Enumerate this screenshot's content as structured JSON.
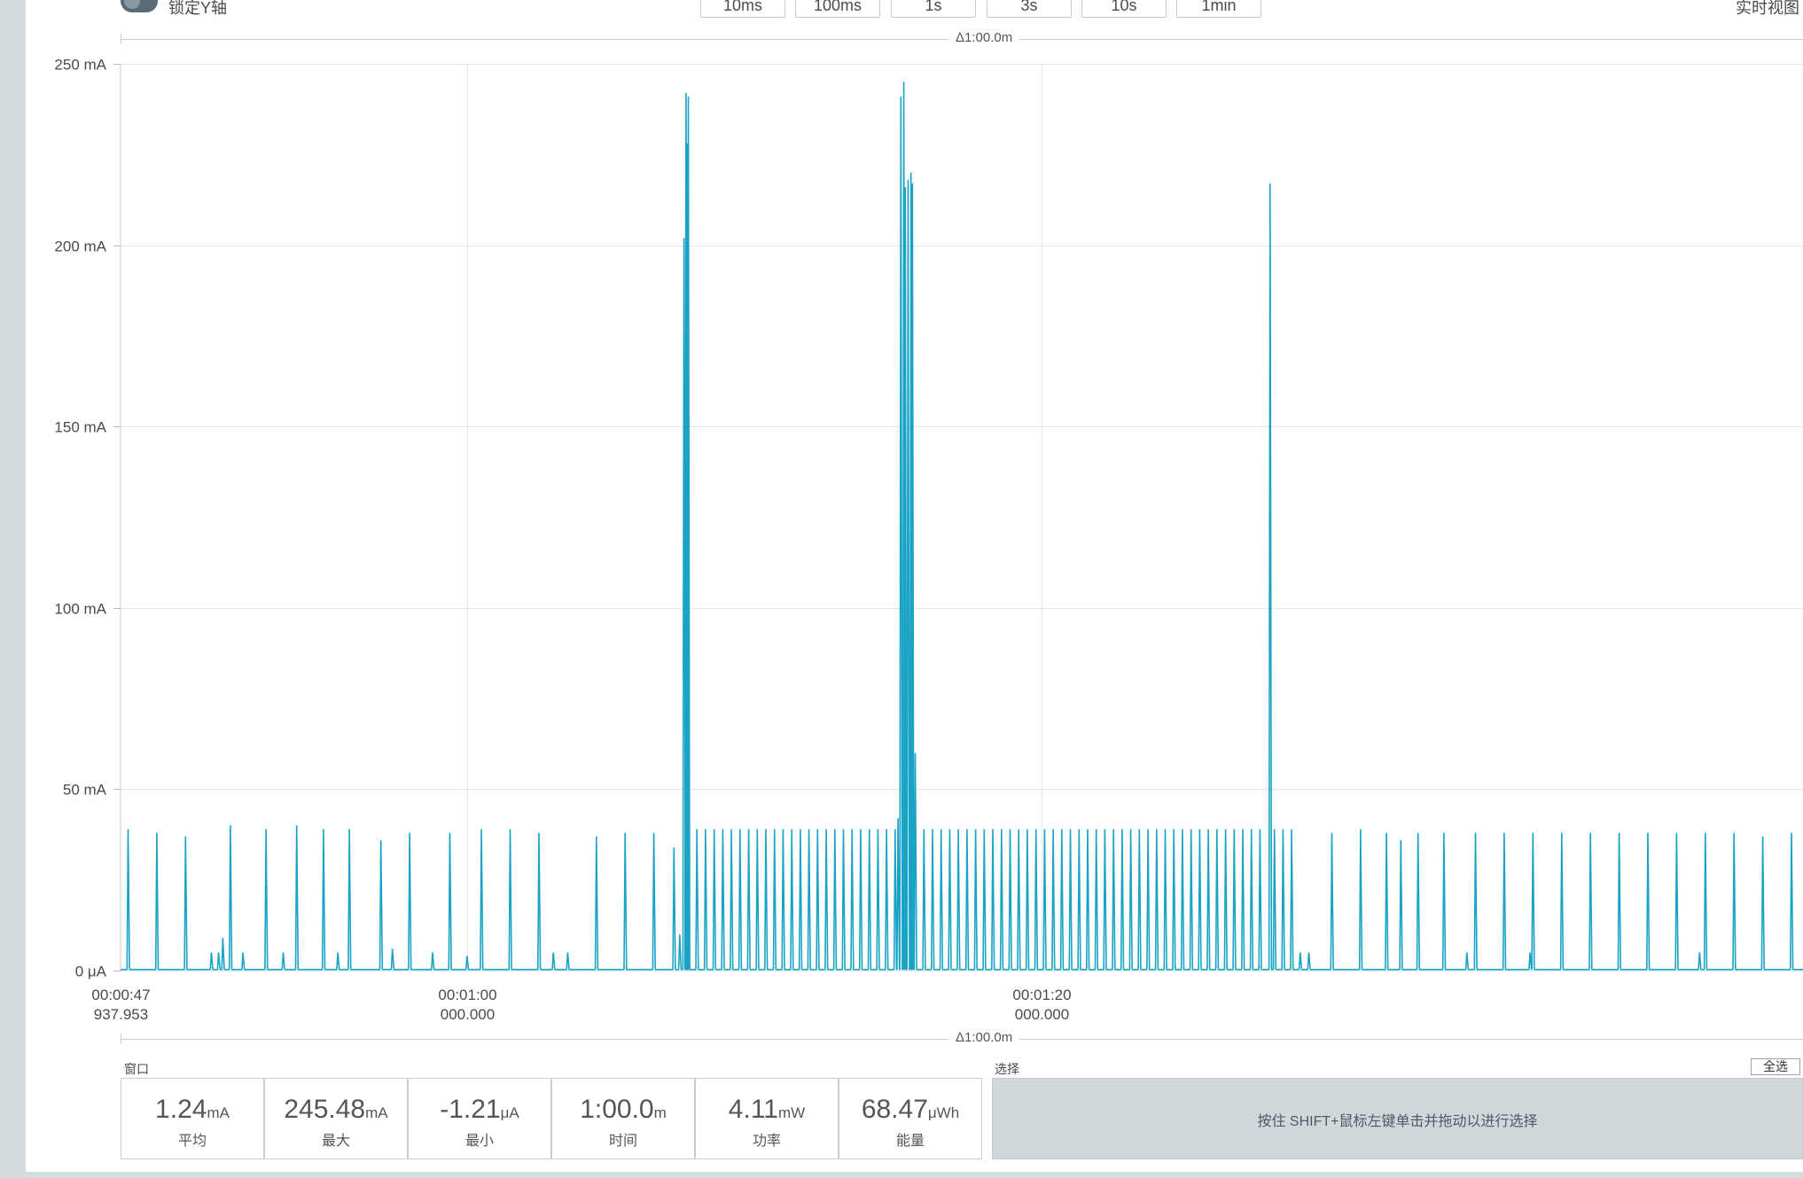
{
  "toolbar": {
    "lock_y_label": "锁定Y轴",
    "window_buttons": [
      "10ms",
      "100ms",
      "1s",
      "3s",
      "10s",
      "1min"
    ],
    "live_view_label": "实时视图"
  },
  "ruler": {
    "top_label": "Δ1:00.0m",
    "bottom_label": "Δ1:00.0m"
  },
  "chart_data": {
    "type": "line",
    "title": "",
    "xlabel": "",
    "ylabel": "",
    "y_unit": "mA",
    "ylim": [
      0,
      250
    ],
    "x_unit": "s",
    "xlim": [
      47.937953,
      106.5
    ],
    "y_ticks": [
      {
        "value": 0,
        "label": "0 μA"
      },
      {
        "value": 50,
        "label": "50 mA"
      },
      {
        "value": 100,
        "label": "100 mA"
      },
      {
        "value": 150,
        "label": "150 mA"
      },
      {
        "value": 200,
        "label": "200 mA"
      },
      {
        "value": 250,
        "label": "250 mA"
      }
    ],
    "x_ticks": [
      {
        "value": 47.937953,
        "line1": "00:00:47",
        "line2": "937.953"
      },
      {
        "value": 60,
        "line1": "00:01:00",
        "line2": "000.000"
      },
      {
        "value": 80,
        "line1": "00:01:20",
        "line2": "000.000"
      }
    ],
    "grid": true,
    "color": "#1ba3c6",
    "series": [
      {
        "baseline_mA": 0.3,
        "spikes": [
          {
            "t": 48.2,
            "v": 39
          },
          {
            "t": 49.2,
            "v": 38
          },
          {
            "t": 50.2,
            "v": 37
          },
          {
            "t": 51.1,
            "v": 5
          },
          {
            "t": 51.35,
            "v": 5
          },
          {
            "t": 51.5,
            "v": 9
          },
          {
            "t": 51.76,
            "v": 40
          },
          {
            "t": 52.2,
            "v": 5
          },
          {
            "t": 53.0,
            "v": 39
          },
          {
            "t": 53.6,
            "v": 5
          },
          {
            "t": 54.07,
            "v": 40
          },
          {
            "t": 55.0,
            "v": 39
          },
          {
            "t": 55.5,
            "v": 5
          },
          {
            "t": 55.9,
            "v": 39
          },
          {
            "t": 57.0,
            "v": 36
          },
          {
            "t": 57.4,
            "v": 6
          },
          {
            "t": 58.0,
            "v": 38
          },
          {
            "t": 58.8,
            "v": 5
          },
          {
            "t": 59.4,
            "v": 38
          },
          {
            "t": 60.0,
            "v": 4
          },
          {
            "t": 60.5,
            "v": 39
          },
          {
            "t": 61.5,
            "v": 39
          },
          {
            "t": 62.5,
            "v": 38
          },
          {
            "t": 63.0,
            "v": 5
          },
          {
            "t": 63.5,
            "v": 5
          },
          {
            "t": 64.5,
            "v": 37
          },
          {
            "t": 65.5,
            "v": 38
          },
          {
            "t": 66.5,
            "v": 38
          },
          {
            "t": 67.2,
            "v": 34
          },
          {
            "t": 67.4,
            "v": 10
          },
          {
            "t": 67.55,
            "v": 202
          },
          {
            "t": 67.62,
            "v": 242
          },
          {
            "t": 67.66,
            "v": 228
          },
          {
            "t": 67.7,
            "v": 241
          },
          {
            "t": 68.0,
            "v": 39
          },
          {
            "t": 68.3,
            "v": 39
          },
          {
            "t": 68.6,
            "v": 39
          },
          {
            "t": 68.9,
            "v": 39
          },
          {
            "t": 69.2,
            "v": 39
          },
          {
            "t": 69.5,
            "v": 39
          },
          {
            "t": 69.8,
            "v": 39
          },
          {
            "t": 70.1,
            "v": 39
          },
          {
            "t": 70.4,
            "v": 39
          },
          {
            "t": 70.7,
            "v": 39
          },
          {
            "t": 71.0,
            "v": 39
          },
          {
            "t": 71.3,
            "v": 39
          },
          {
            "t": 71.6,
            "v": 39
          },
          {
            "t": 71.9,
            "v": 39
          },
          {
            "t": 72.2,
            "v": 39
          },
          {
            "t": 72.5,
            "v": 39
          },
          {
            "t": 72.8,
            "v": 39
          },
          {
            "t": 73.1,
            "v": 39
          },
          {
            "t": 73.4,
            "v": 39
          },
          {
            "t": 73.7,
            "v": 39
          },
          {
            "t": 74.0,
            "v": 39
          },
          {
            "t": 74.3,
            "v": 39
          },
          {
            "t": 74.6,
            "v": 39
          },
          {
            "t": 74.9,
            "v": 39
          },
          {
            "t": 75.0,
            "v": 42
          },
          {
            "t": 75.1,
            "v": 241
          },
          {
            "t": 75.2,
            "v": 245
          },
          {
            "t": 75.25,
            "v": 216
          },
          {
            "t": 75.35,
            "v": 218
          },
          {
            "t": 75.45,
            "v": 220
          },
          {
            "t": 75.5,
            "v": 217
          },
          {
            "t": 75.6,
            "v": 60
          },
          {
            "t": 75.9,
            "v": 39
          },
          {
            "t": 76.2,
            "v": 39
          },
          {
            "t": 76.5,
            "v": 39
          },
          {
            "t": 76.8,
            "v": 39
          },
          {
            "t": 77.1,
            "v": 39
          },
          {
            "t": 77.4,
            "v": 39
          },
          {
            "t": 77.7,
            "v": 39
          },
          {
            "t": 78.0,
            "v": 39
          },
          {
            "t": 78.3,
            "v": 39
          },
          {
            "t": 78.6,
            "v": 39
          },
          {
            "t": 78.9,
            "v": 39
          },
          {
            "t": 79.2,
            "v": 39
          },
          {
            "t": 79.5,
            "v": 39
          },
          {
            "t": 79.8,
            "v": 39
          },
          {
            "t": 80.1,
            "v": 39
          },
          {
            "t": 80.4,
            "v": 39
          },
          {
            "t": 80.7,
            "v": 39
          },
          {
            "t": 81.0,
            "v": 39
          },
          {
            "t": 81.3,
            "v": 39
          },
          {
            "t": 81.6,
            "v": 39
          },
          {
            "t": 81.9,
            "v": 39
          },
          {
            "t": 82.2,
            "v": 39
          },
          {
            "t": 82.5,
            "v": 39
          },
          {
            "t": 82.8,
            "v": 39
          },
          {
            "t": 83.1,
            "v": 39
          },
          {
            "t": 83.4,
            "v": 39
          },
          {
            "t": 83.7,
            "v": 39
          },
          {
            "t": 84.0,
            "v": 39
          },
          {
            "t": 84.3,
            "v": 39
          },
          {
            "t": 84.6,
            "v": 39
          },
          {
            "t": 84.9,
            "v": 39
          },
          {
            "t": 85.2,
            "v": 39
          },
          {
            "t": 85.5,
            "v": 39
          },
          {
            "t": 85.8,
            "v": 39
          },
          {
            "t": 86.1,
            "v": 39
          },
          {
            "t": 86.4,
            "v": 39
          },
          {
            "t": 86.7,
            "v": 39
          },
          {
            "t": 87.0,
            "v": 39
          },
          {
            "t": 87.3,
            "v": 39
          },
          {
            "t": 87.6,
            "v": 39
          },
          {
            "t": 87.95,
            "v": 217
          },
          {
            "t": 88.1,
            "v": 39
          },
          {
            "t": 88.4,
            "v": 39
          },
          {
            "t": 88.7,
            "v": 39
          },
          {
            "t": 89.0,
            "v": 5
          },
          {
            "t": 89.3,
            "v": 5
          },
          {
            "t": 90.1,
            "v": 38
          },
          {
            "t": 91.1,
            "v": 39
          },
          {
            "t": 92.0,
            "v": 38
          },
          {
            "t": 92.5,
            "v": 36
          },
          {
            "t": 93.1,
            "v": 38
          },
          {
            "t": 94.0,
            "v": 38
          },
          {
            "t": 94.8,
            "v": 5
          },
          {
            "t": 95.1,
            "v": 38
          },
          {
            "t": 96.1,
            "v": 38
          },
          {
            "t": 97.0,
            "v": 5
          },
          {
            "t": 97.1,
            "v": 38
          },
          {
            "t": 98.1,
            "v": 38
          },
          {
            "t": 99.1,
            "v": 38
          },
          {
            "t": 100.1,
            "v": 38
          },
          {
            "t": 101.1,
            "v": 38
          },
          {
            "t": 102.1,
            "v": 38
          },
          {
            "t": 102.9,
            "v": 5
          },
          {
            "t": 103.1,
            "v": 38
          },
          {
            "t": 104.1,
            "v": 38
          },
          {
            "t": 105.1,
            "v": 37
          },
          {
            "t": 106.1,
            "v": 38
          }
        ]
      }
    ]
  },
  "stats": {
    "window_label": "窗口",
    "selection_label": "选择",
    "items": [
      {
        "value": "1.24",
        "unit": "mA",
        "label": "平均"
      },
      {
        "value": "245.48",
        "unit": "mA",
        "label": "最大"
      },
      {
        "value": "-1.21",
        "unit": "μA",
        "label": "最小"
      },
      {
        "value": "1:00.0",
        "unit": "m",
        "label": "时间"
      },
      {
        "value": "4.11",
        "unit": "mW",
        "label": "功率"
      },
      {
        "value": "68.47",
        "unit": "μWh",
        "label": "能量"
      }
    ],
    "select_hint": "按住 SHIFT+鼠标左键单击并拖动以进行选择",
    "select_all_label": "全选"
  }
}
